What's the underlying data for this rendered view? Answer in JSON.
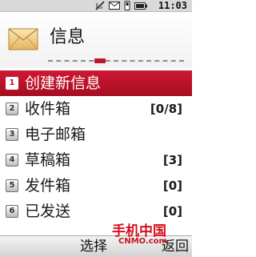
{
  "status_bar": {
    "time": "11:03",
    "icons": [
      "signal-off-icon",
      "envelope-status-icon",
      "phone-status-icon",
      "battery-icon"
    ]
  },
  "header": {
    "icon": "envelope-icon",
    "title": "信息"
  },
  "menu": {
    "items": [
      {
        "number": "1",
        "label": "创建新信息",
        "count": "",
        "selected": true
      },
      {
        "number": "2",
        "label": "收件箱",
        "count": "[0/8]",
        "selected": false
      },
      {
        "number": "3",
        "label": "电子邮箱",
        "count": "",
        "selected": false
      },
      {
        "number": "4",
        "label": "草稿箱",
        "count": "[3]",
        "selected": false
      },
      {
        "number": "5",
        "label": "发件箱",
        "count": "[0]",
        "selected": false
      },
      {
        "number": "6",
        "label": "已发送",
        "count": "[0]",
        "selected": false
      }
    ]
  },
  "softkeys": {
    "left": "选择",
    "right": "返回"
  },
  "watermark": {
    "text": "手机中国",
    "subtext": "CNMO.com"
  },
  "colors": {
    "accent": "#c2142d",
    "status_bar": "#d9d9d9"
  }
}
